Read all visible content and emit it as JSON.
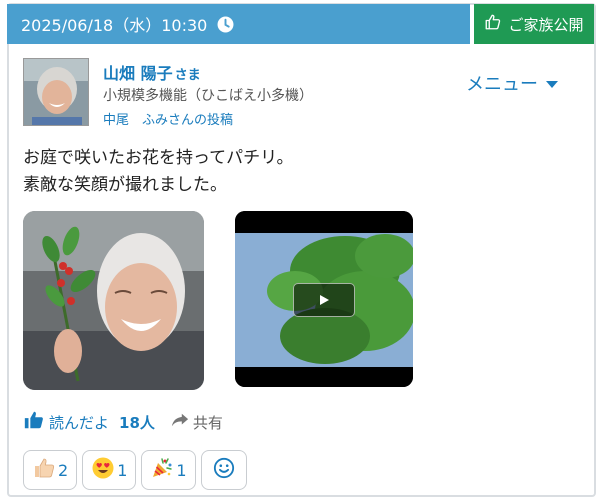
{
  "header": {
    "datetime": "2025/06/18（水）10:30",
    "family_badge": "ご家族公開"
  },
  "post": {
    "resident_name": "山畑 陽子",
    "honorific": "さま",
    "facility": "小規模多機能（ひこばえ小多機）",
    "poster": "中尾　ふみさんの投稿",
    "menu_label": "メニュー",
    "body_lines": [
      "お庭で咲いたお花を持ってパチリ。",
      "素敵な笑顔が撮れました。"
    ]
  },
  "actions": {
    "read_label": "読んだよ",
    "read_count": "18人",
    "share_label": "共有"
  },
  "reactions": [
    {
      "icon": "thumbs-up-emoji",
      "count": "2"
    },
    {
      "icon": "heart-eyes-emoji",
      "count": "1"
    },
    {
      "icon": "party-popper-emoji",
      "count": "1"
    }
  ],
  "colors": {
    "header_blue": "#4a9fcf",
    "badge_green": "#1f9a54",
    "link_blue": "#1a7cbd"
  }
}
